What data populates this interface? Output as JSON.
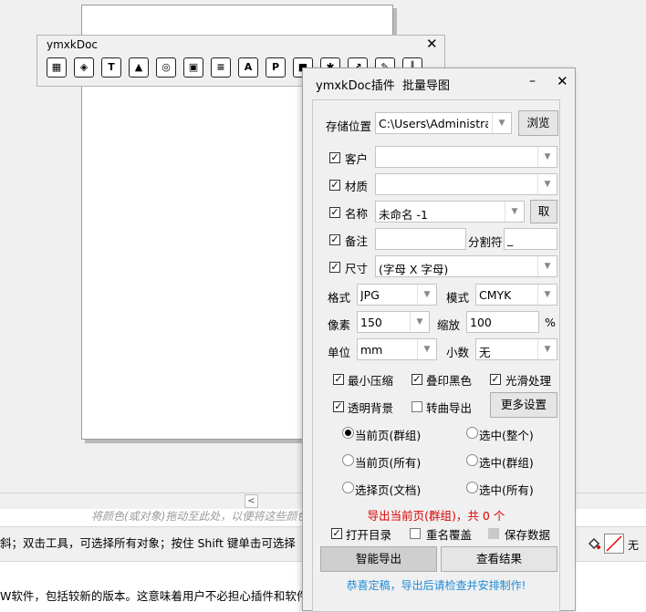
{
  "toolbar_window": {
    "title": "ymxkDoc",
    "close": "✕",
    "icons": [
      "qr-icon",
      "cube-icon",
      "text-tool-icon",
      "image-icon",
      "car-icon",
      "select-frame-icon",
      "library-icon",
      "font-a-icon",
      "ps-icon",
      "bitmap-icon",
      "gear-icon",
      "export-icon",
      "trace-icon",
      "barcode-icon"
    ]
  },
  "canvas": {
    "palette_hint": "将颜色(或对象)拖动至此处，以便将这些颜色",
    "status_text": "斜；双击工具，可选择所有对象；按住 Shift 键单击可选择",
    "outline_label": "无",
    "bottom_text": "W软件，包括较新的版本。这意味着用户不必担心插件和软件"
  },
  "dialog": {
    "title": "ymxkDoc插件",
    "subtitle": "批量导图",
    "min": "–",
    "close": "✕",
    "save_location": {
      "label": "存储位置",
      "value": "C:\\Users\\Administra",
      "browse": "浏览"
    },
    "customer": {
      "label": "客户",
      "value": "",
      "checked": true
    },
    "material": {
      "label": "材质",
      "value": "",
      "checked": true
    },
    "name": {
      "label": "名称",
      "value": "未命名 -1",
      "take": "取",
      "checked": true
    },
    "note": {
      "label": "备注",
      "value": "",
      "separator_label": "分割符",
      "separator_value": "_",
      "checked": true
    },
    "size": {
      "label": "尺寸",
      "value": "(字母 X 字母)",
      "checked": true
    },
    "format": {
      "label": "格式",
      "value": "JPG"
    },
    "mode": {
      "label": "模式",
      "value": "CMYK"
    },
    "pixel": {
      "label": "像素",
      "value": "150"
    },
    "scale": {
      "label": "缩放",
      "value": "100",
      "unit": "%"
    },
    "unit": {
      "label": "单位",
      "value": "mm"
    },
    "decimals": {
      "label": "小数",
      "value": "无"
    },
    "options": {
      "min_compress": "最小压缩",
      "overprint_black": "叠印黑色",
      "smooth": "光滑处理",
      "transparent_bg": "透明背景",
      "curve_export": "转曲导出",
      "more_settings": "更多设置"
    },
    "scopes": [
      "当前页(群组)",
      "选中(整个)",
      "当前页(所有)",
      "选中(群组)",
      "选择页(文档)",
      "选中(所有)"
    ],
    "export_message": "导出当前页(群组)，共 0 个",
    "open_dir": "打开目录",
    "rename_overwrite": "重名覆盖",
    "save_data": "保存数据",
    "smart_export": "智能导出",
    "view_result": "查看结果",
    "footer_note": "恭喜定稿，导出后请检查并安排制作!"
  }
}
